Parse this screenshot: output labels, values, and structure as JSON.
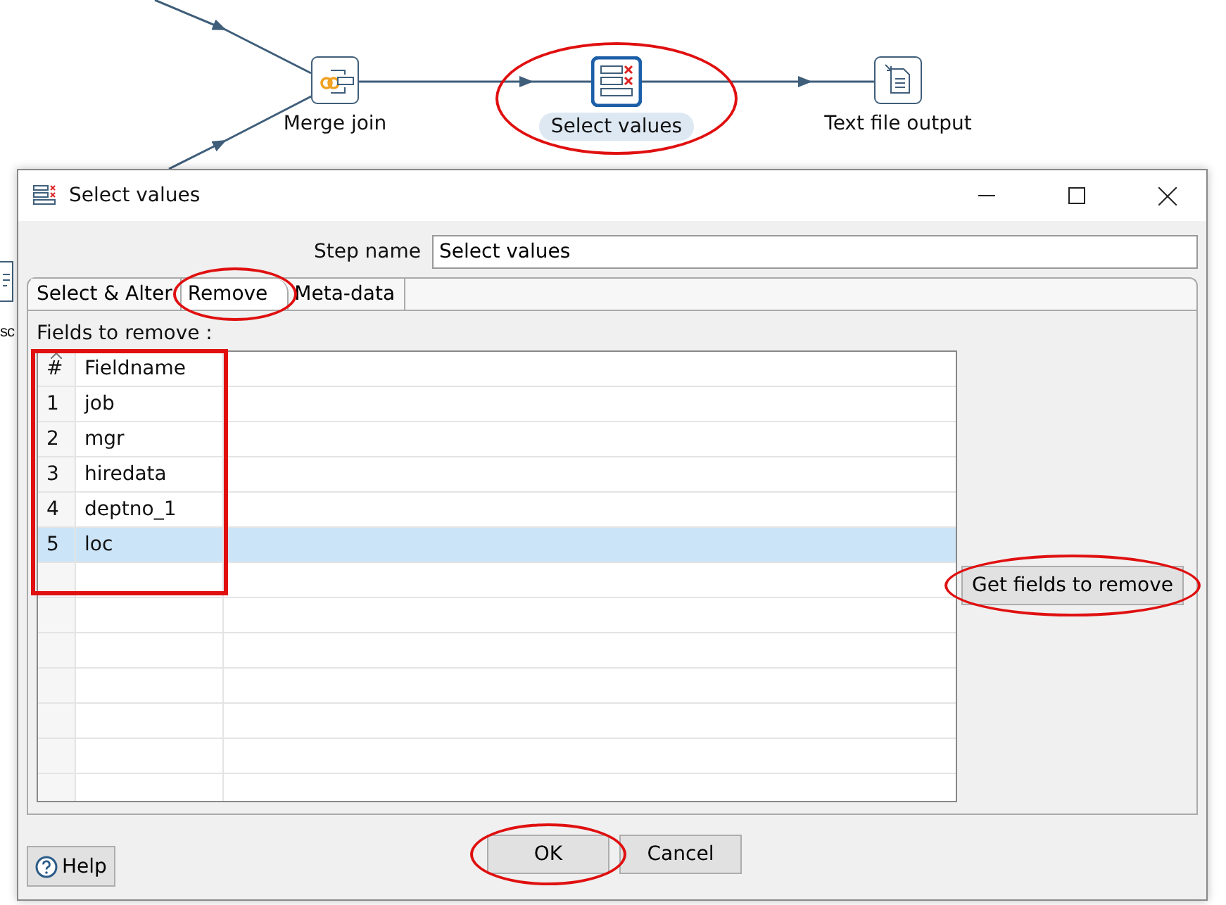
{
  "canvas": {
    "steps": [
      {
        "label": "Merge join",
        "kind": "merge",
        "selected": false,
        "circled": false
      },
      {
        "label": "Select values",
        "kind": "select",
        "selected": true,
        "circled": true
      },
      {
        "label": "Text file output",
        "kind": "file",
        "selected": false,
        "circled": false
      }
    ],
    "partial_label": "sc"
  },
  "dialog": {
    "title": "Select values",
    "step_name_label": "Step name",
    "step_name": "Select values",
    "tabs": [
      {
        "label": "Select & Alter",
        "selected": false,
        "circled": false
      },
      {
        "label": "Remove",
        "selected": true,
        "circled": true
      },
      {
        "label": "Meta-data",
        "selected": false,
        "circled": false
      }
    ],
    "fields_label": "Fields to remove :",
    "table": {
      "columns": [
        "#",
        "Fieldname"
      ],
      "boxed": true,
      "rows": [
        {
          "cells": [
            "1",
            "job"
          ],
          "selected": false
        },
        {
          "cells": [
            "2",
            "mgr"
          ],
          "selected": false
        },
        {
          "cells": [
            "3",
            "hiredata"
          ],
          "selected": false
        },
        {
          "cells": [
            "4",
            "deptno_1"
          ],
          "selected": false
        },
        {
          "cells": [
            "5",
            "loc"
          ],
          "selected": true
        }
      ]
    },
    "get_fields_button": {
      "label": "Get fields to remove",
      "circled": true
    },
    "buttons": [
      {
        "label": "OK",
        "circled": true
      },
      {
        "label": "Cancel",
        "circled": false
      }
    ],
    "help": "Help"
  }
}
